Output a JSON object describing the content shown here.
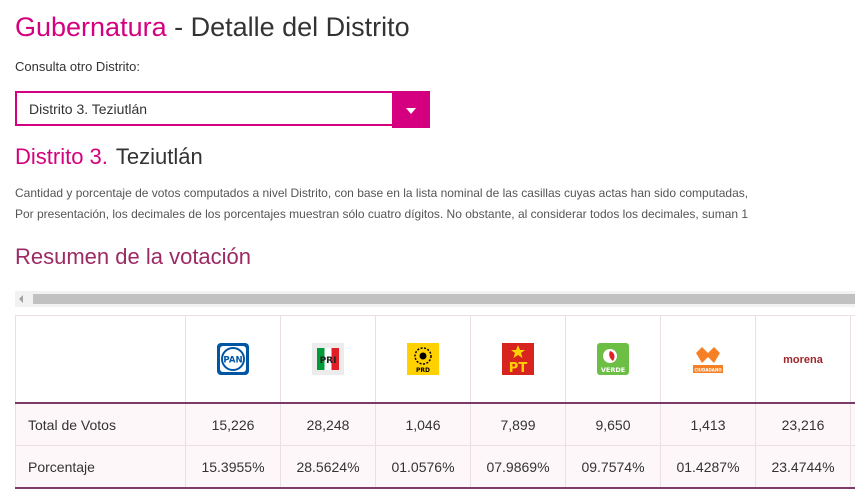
{
  "header": {
    "title_accent": "Gubernatura",
    "title_rest": " - Detalle del Distrito"
  },
  "district_select": {
    "label": "Consulta otro Distrito:",
    "selected": "Distrito 3. Teziutlán"
  },
  "district": {
    "number_label": "Distrito 3.",
    "name": "Teziutlán"
  },
  "description": {
    "line1": "Cantidad y porcentaje de votos computados a nivel Distrito, con base en la lista nominal de las casillas cuyas actas han sido computadas,",
    "line2": "Por presentación, los decimales de los porcentajes muestran sólo cuatro dígitos. No obstante, al considerar todos los decimales, suman 1"
  },
  "summary": {
    "title": "Resumen de la votación",
    "rows": [
      {
        "label": "Total de Votos",
        "values": [
          "15,226",
          "28,248",
          "1,046",
          "7,899",
          "9,650",
          "1,413",
          "23,216"
        ]
      },
      {
        "label": "Porcentaje",
        "values": [
          "15.3955%",
          "28.5624%",
          "01.0576%",
          "07.9869%",
          "09.7574%",
          "01.4287%",
          "23.4744%"
        ]
      }
    ],
    "parties": [
      {
        "icon": "pan-logo-icon",
        "text": "PAN",
        "color": "#0055a5"
      },
      {
        "icon": "pri-logo-icon",
        "text": "PRI",
        "colors": [
          "#009c3c",
          "#ffffff",
          "#e21e26"
        ]
      },
      {
        "icon": "prd-logo-icon",
        "text": "PRD",
        "color": "#ffd100"
      },
      {
        "icon": "pt-logo-icon",
        "text": "PT",
        "color": "#d8241f"
      },
      {
        "icon": "verde-logo-icon",
        "text": "VERDE",
        "color": "#6cbe45"
      },
      {
        "icon": "movimiento-ciudadano-logo-icon",
        "text": "CIUDADANO",
        "color": "#f58025"
      },
      {
        "icon": "morena-logo-icon",
        "text": "morena",
        "color": "#a0262a"
      }
    ]
  },
  "colors": {
    "accent": "#d5007f",
    "section": "#9c2a64",
    "table_border": "#7d3b6a"
  }
}
